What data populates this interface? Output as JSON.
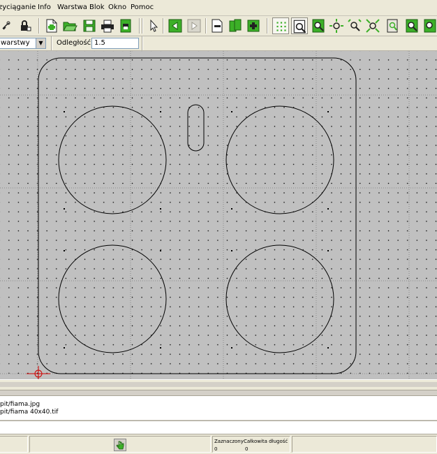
{
  "menu": [
    "Przyciąganie",
    "Info",
    "Warstwa",
    "Blok",
    "Okno",
    "Pomoc"
  ],
  "toolbar": {
    "icons": [
      "layer-link-icon",
      "lock-icon",
      "new-file-icon",
      "open-folder-icon",
      "save-icon",
      "print-icon",
      "print-preview-icon",
      "undo-icon",
      "redo-icon",
      "select-pointer-icon",
      "minus-icon",
      "block-icon",
      "add-block-icon",
      "grid-icon",
      "zoom-window-icon",
      "zoom-in-icon",
      "zoom-move-icon",
      "zoom-out-icon",
      "zoom-extents-icon",
      "zoom-previous-icon",
      "zoom-auto-icon",
      "zoom-redraw-icon"
    ]
  },
  "options": {
    "layer_value": "warstwy",
    "distance_label": "Odległość:",
    "distance_value": "1.5"
  },
  "history": {
    "line1": "pit/fiama.jpg",
    "line2": "pit/fiama 40x40.tif"
  },
  "status": {
    "selected_label": "Zaznaczony",
    "selected_value": "0",
    "total_length_label": "Całkowita długość",
    "total_length_value": "0"
  },
  "colors": {
    "canvas": "#c0c0c0",
    "accent_green": "#3cb028",
    "cursor_red": "#d00000"
  }
}
